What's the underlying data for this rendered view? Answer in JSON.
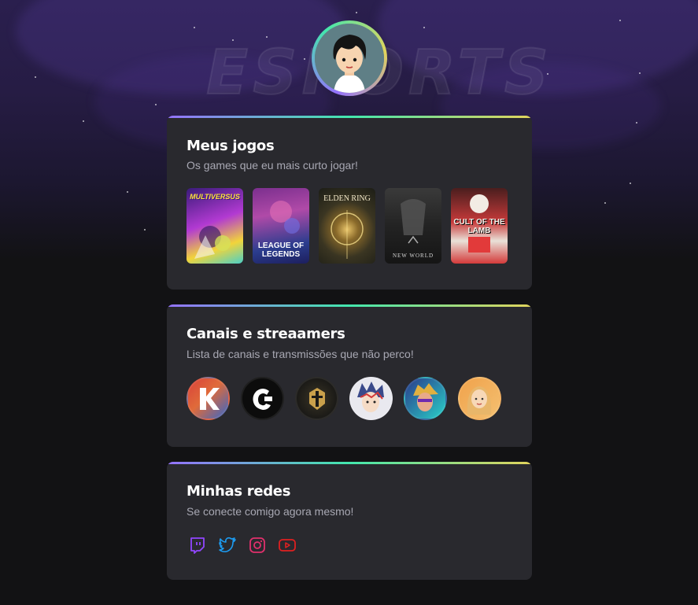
{
  "background": {
    "watermark_text": "ESPORTS"
  },
  "profile": {
    "avatar_icon": "cartoon-boy-avatar"
  },
  "sections": {
    "games": {
      "title": "Meus jogos",
      "subtitle": "Os games que eu mais curto jogar!",
      "items": [
        {
          "name": "MultiVersus",
          "caption": "MULTIVERSUS"
        },
        {
          "name": "League of Legends",
          "caption": "LEAGUE OF LEGENDS"
        },
        {
          "name": "Elden Ring",
          "caption": "ELDEN RING"
        },
        {
          "name": "New World",
          "caption": "NEW WORLD"
        },
        {
          "name": "Cult of the Lamb",
          "caption": "CULT OF THE LAMB"
        }
      ]
    },
    "channels": {
      "title": "Canais e streaamers",
      "subtitle": "Lista de canais e transmissões que não perco!",
      "items": [
        {
          "icon": "k-logo-icon",
          "colors": [
            "#d9413a",
            "#3466c9"
          ]
        },
        {
          "icon": "c-logo-icon",
          "colors": [
            "#0c0c0c",
            "#ffffff"
          ]
        },
        {
          "icon": "golden-helmet-icon",
          "colors": [
            "#1b1a17",
            "#c9a04b"
          ]
        },
        {
          "icon": "anime-character-icon",
          "colors": [
            "#e9e9ef",
            "#3a4a8a"
          ]
        },
        {
          "icon": "hero-character-icon",
          "colors": [
            "#2a3a8a",
            "#e2b040"
          ]
        },
        {
          "icon": "girl-portrait-icon",
          "colors": [
            "#f0a24b",
            "#f7d8b8"
          ]
        }
      ]
    },
    "socials": {
      "title": "Minhas redes",
      "subtitle": "Se conecte comigo agora mesmo!",
      "items": [
        {
          "icon": "twitch-icon",
          "color": "#9146ff"
        },
        {
          "icon": "twitter-icon",
          "color": "#1d9bf0"
        },
        {
          "icon": "instagram-icon",
          "color": "#e1306c"
        },
        {
          "icon": "youtube-icon",
          "color": "#e02020"
        }
      ]
    }
  },
  "colors": {
    "accent_start": "#9572fc",
    "accent_mid": "#43e7ad",
    "accent_end": "#e2d45c",
    "card_bg": "#29292e"
  }
}
